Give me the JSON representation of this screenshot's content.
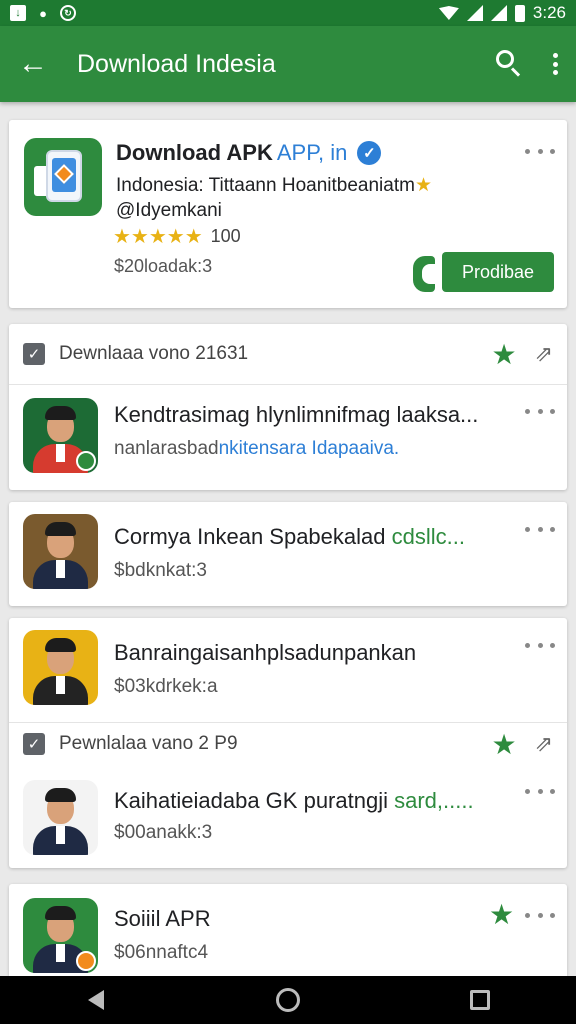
{
  "status_bar": {
    "time": "3:26"
  },
  "app_bar": {
    "title": "Download Indesia"
  },
  "featured": {
    "title_main": "Download APK",
    "title_accent": "APP, in",
    "verified_glyph": "✓",
    "subtitle_line1": "Indonesia: Tittaann Hoanitbeaniatm",
    "subtitle_line2": "@Idyemkani",
    "rating_stars": "★★★★★",
    "rating_count": "100",
    "size": "$20loadak:3",
    "install_label": "Prodibae"
  },
  "sections": [
    {
      "label": "Dewnlaaa vono 21631",
      "apps": [
        {
          "title": "Kendtrasimag hlynlimnifmag laaksa...",
          "subtitle_plain": "nanlarasbad",
          "subtitle_blue": "nkitensara Idapaaiva.",
          "bg": "#1d6b35",
          "shirt": "#d63b2f",
          "badge": "#2e8b3e"
        },
        {
          "title": "Cormya Inkean Spabekalad",
          "title_green": "cdsllc...",
          "subtitle_plain": "$bdknkat:3",
          "bg": "#7a5a2e",
          "shirt": "#1f2a44",
          "badge": ""
        },
        {
          "title": "Banraingaisanhplsadunpankan",
          "subtitle_plain": "$03kdrkek:a",
          "bg": "#e8b215",
          "shirt": "#232323",
          "badge": ""
        }
      ]
    },
    {
      "label": "Pewnlalaa vano 2 P9",
      "apps": [
        {
          "title": "Kaihatieiadaba GK puratngji",
          "title_green": "sard,.....",
          "subtitle_plain": "$00anakk:3",
          "bg": "#f3f3f3",
          "shirt": "#1f2a44",
          "badge": ""
        },
        {
          "title": "Soiiil APR",
          "subtitle_plain": "$06nnaftc4",
          "bg": "#2e8b3e",
          "shirt": "#1f2a44",
          "badge": "#f28b1e"
        }
      ]
    }
  ]
}
